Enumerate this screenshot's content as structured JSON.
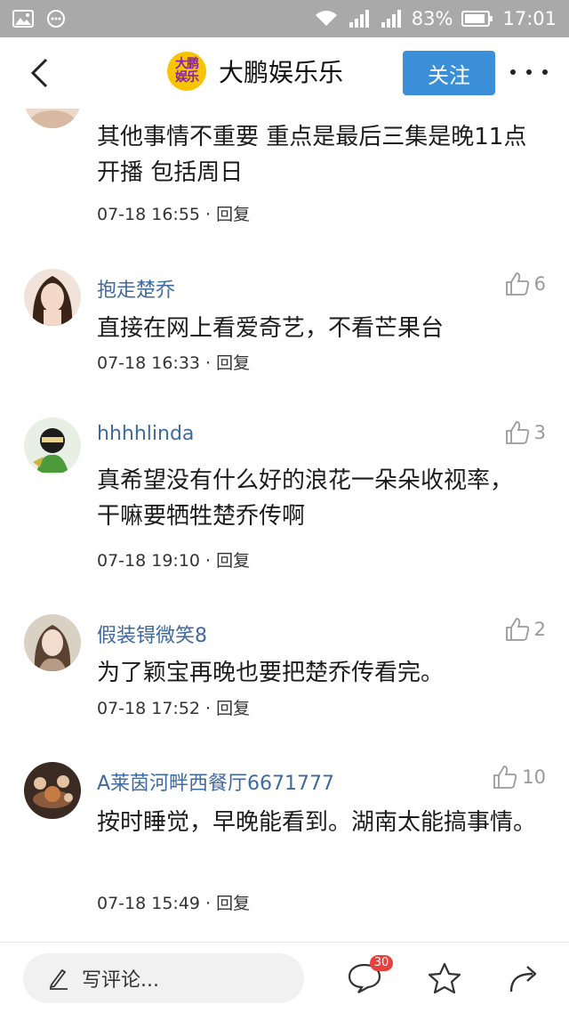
{
  "status_bar": {
    "battery_percent": "83%",
    "time": "17:01",
    "icons": [
      "image-icon",
      "message-icon",
      "wifi-icon",
      "signal-icon",
      "signal-icon",
      "battery-icon"
    ]
  },
  "header": {
    "logo_text": "大鹏娱乐",
    "account_name": "大鹏娱乐乐",
    "follow_label": "关注",
    "colors": {
      "follow_bg": "#3a8fd8",
      "logo_bg": "#f6c400",
      "logo_text": "#8a1db6"
    }
  },
  "comments": [
    {
      "username": "",
      "text": "其他事情不重要 重点是最后三集是晚11点开播 包括周日",
      "date": "07-18 16:55",
      "separator": " · ",
      "reply": "回复",
      "likes": ""
    },
    {
      "username": "抱走楚乔",
      "text": "直接在网上看爱奇艺，不看芒果台",
      "date": "07-18 16:33",
      "separator": " · ",
      "reply": "回复",
      "likes": "6"
    },
    {
      "username": "hhhhlinda",
      "text": "真希望没有什么好的浪花一朵朵收视率，干嘛要牺牲楚乔传啊",
      "date": "07-18 19:10",
      "separator": " · ",
      "reply": "回复",
      "likes": "3"
    },
    {
      "username": "假装锝微笑8",
      "text": "为了颖宝再晚也要把楚乔传看完。",
      "date": "07-18 17:52",
      "separator": " · ",
      "reply": "回复",
      "likes": "2"
    },
    {
      "username": "A莱茵河畔西餐厅6671777",
      "text": "按时睡觉，早晚能看到。湖南太能搞事情。",
      "date": "07-18 15:49",
      "separator": " · ",
      "reply": "回复",
      "likes": "10"
    }
  ],
  "bottom_bar": {
    "write_placeholder": "写评论...",
    "comment_count": "30"
  },
  "colors": {
    "username": "#3f6aa0",
    "status_bar_bg": "#a9a9a9",
    "badge": "#e5413f"
  }
}
